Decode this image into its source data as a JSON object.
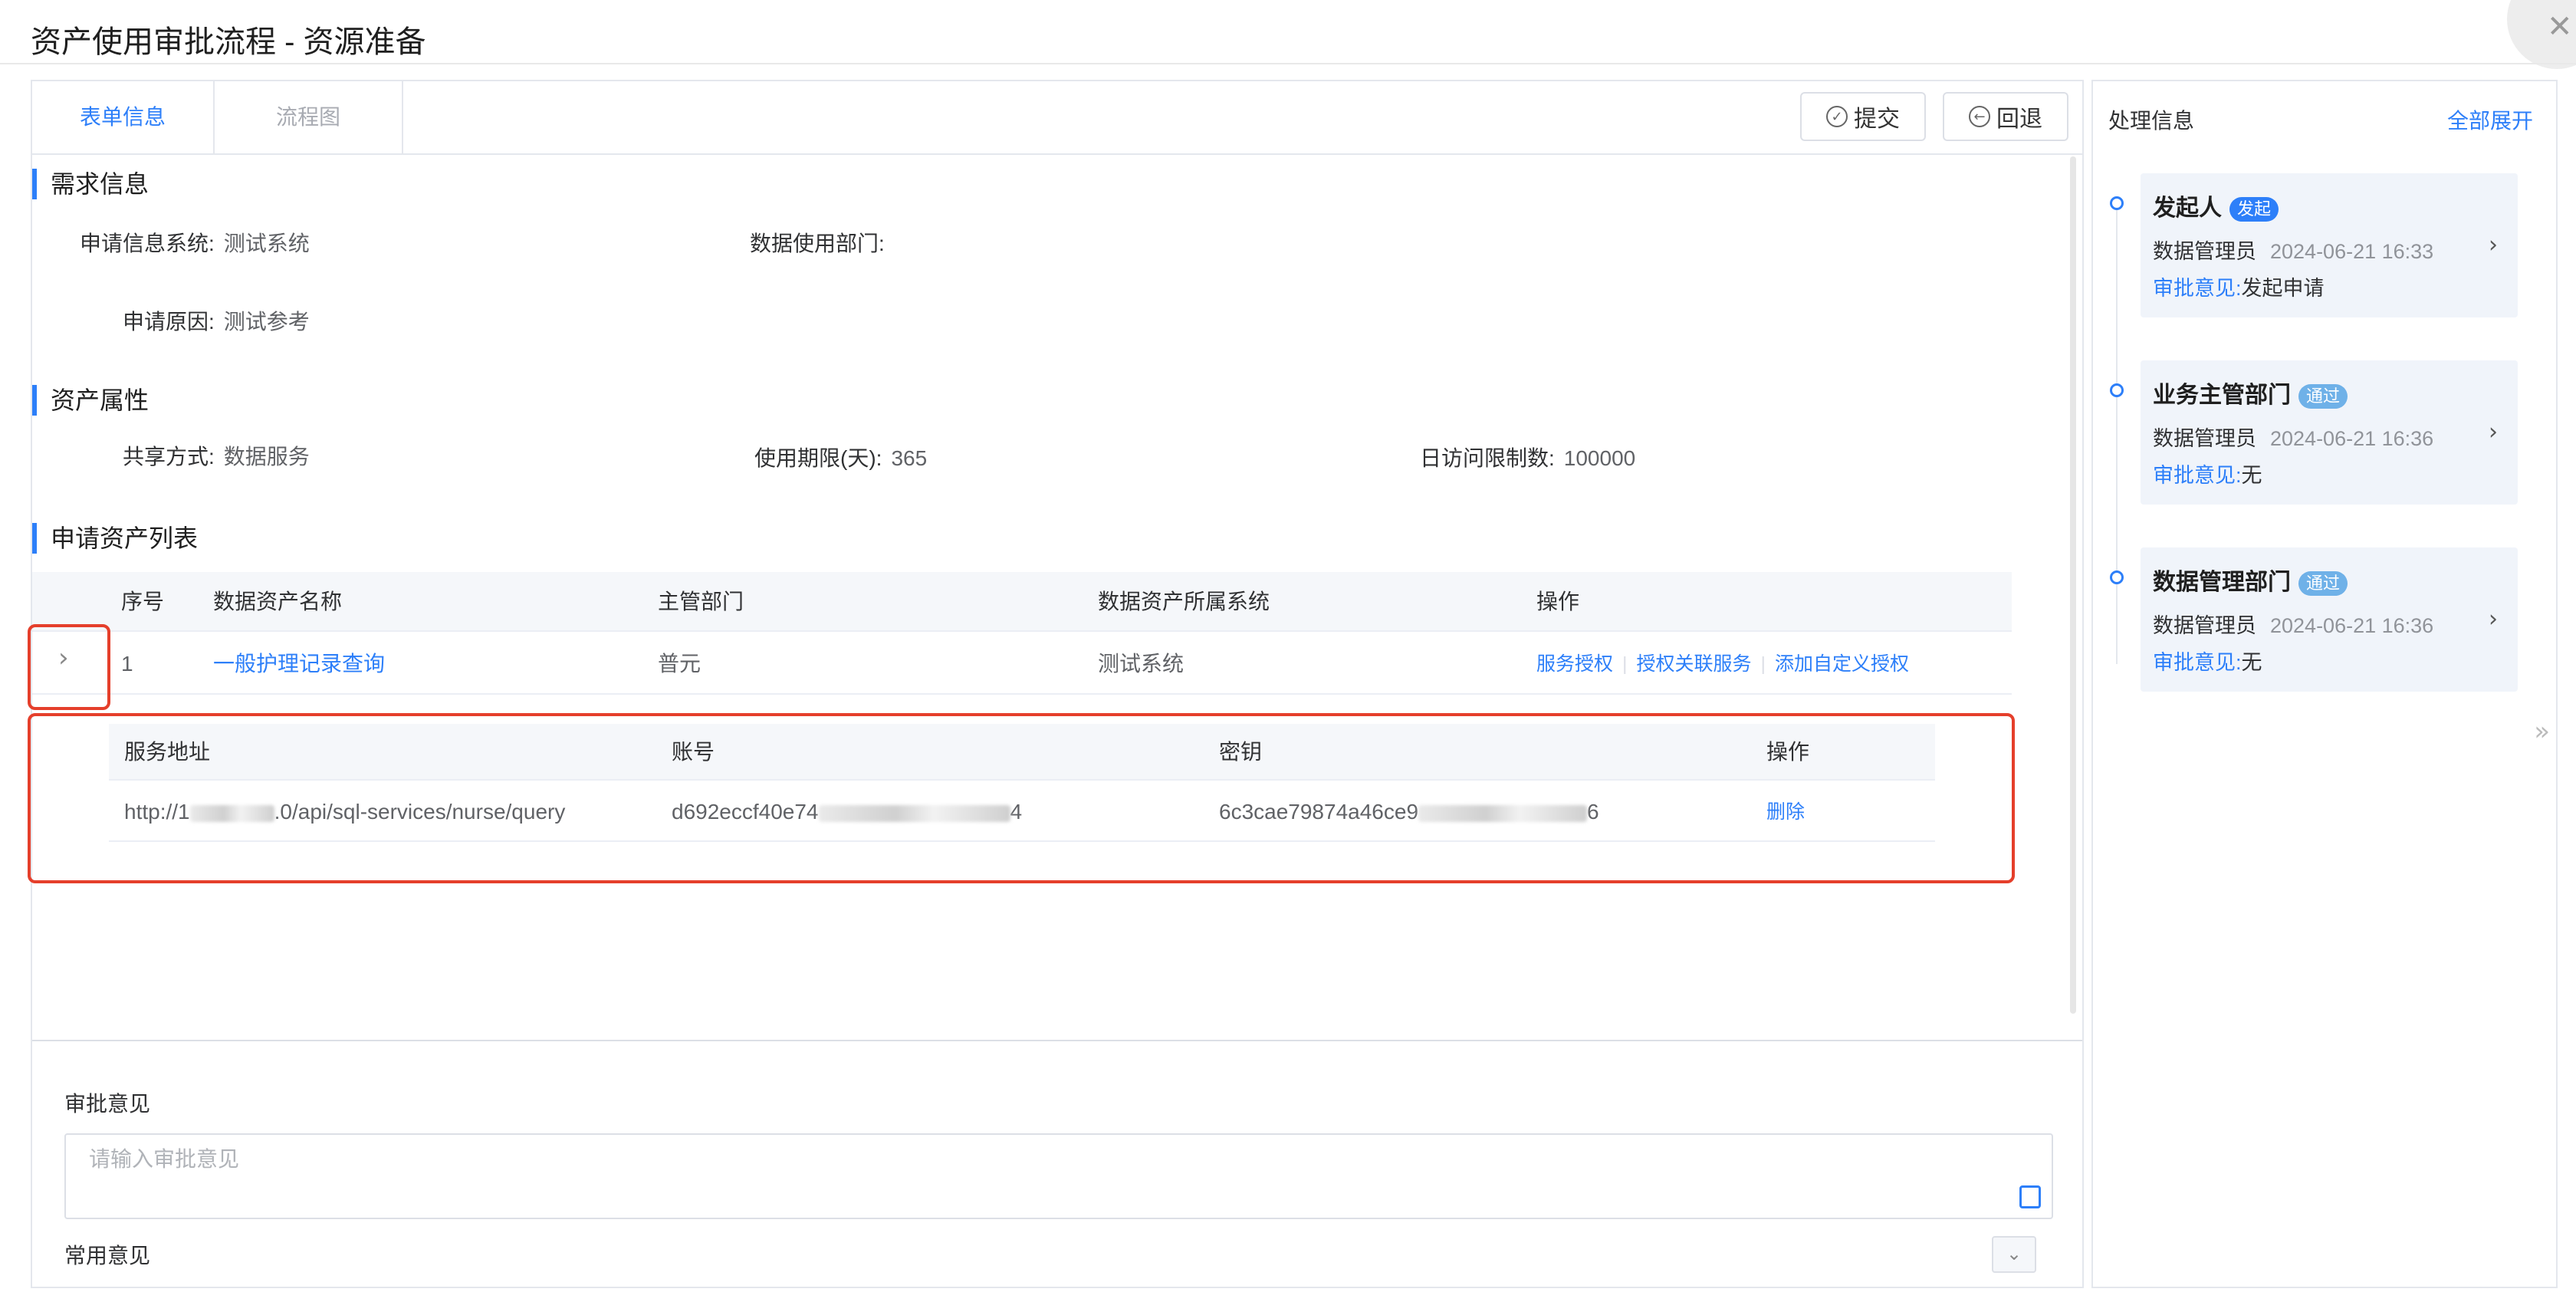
{
  "modal": {
    "title": "资产使用审批流程 - 资源准备",
    "close_icon": "close-icon"
  },
  "tabs": [
    {
      "label": "表单信息"
    },
    {
      "label": "流程图"
    }
  ],
  "toolbar": {
    "submit_label": "提交",
    "back_label": "回退"
  },
  "demand": {
    "title": "需求信息",
    "system_label": "申请信息系统:",
    "system_value": "测试系统",
    "dept_label": "数据使用部门:",
    "dept_value": "",
    "reason_label": "申请原因:",
    "reason_value": "测试参考"
  },
  "asset_props": {
    "title": "资产属性",
    "share_label": "共享方式:",
    "share_value": "数据服务",
    "period_label": "使用期限(天):",
    "period_value": "365",
    "limit_label": "日访问限制数:",
    "limit_value": "100000"
  },
  "asset_list": {
    "title": "申请资产列表",
    "columns": [
      "序号",
      "数据资产名称",
      "主管部门",
      "数据资产所属系统",
      "操作"
    ],
    "rows": [
      {
        "index": "1",
        "name": "一般护理记录查询",
        "dept": "普元",
        "system": "测试系统",
        "ops": [
          "服务授权",
          "授权关联服务",
          "添加自定义授权"
        ]
      }
    ]
  },
  "service_table": {
    "columns": [
      "服务地址",
      "账号",
      "密钥",
      "操作"
    ],
    "row": {
      "address_prefix": "http://1",
      "address_suffix": ".0/api/sql-services/nurse/query",
      "account_prefix": "d692eccf40e74",
      "account_suffix": "4",
      "secret_prefix": "6c3cae79874a46ce9",
      "secret_suffix": "6",
      "action": "删除"
    }
  },
  "opinion": {
    "label": "审批意见",
    "placeholder": "请输入审批意见",
    "common_label": "常用意见"
  },
  "process_panel": {
    "title": "处理信息",
    "expand_all": "全部展开",
    "steps": [
      {
        "title": "发起人",
        "badge": "发起",
        "user": "数据管理员",
        "time": "2024-06-21 16:33",
        "opinion_key": "审批意见:",
        "opinion": "发起申请"
      },
      {
        "title": "业务主管部门",
        "badge": "通过",
        "user": "数据管理员",
        "time": "2024-06-21 16:36",
        "opinion_key": "审批意见:",
        "opinion": "无"
      },
      {
        "title": "数据管理部门",
        "badge": "通过",
        "user": "数据管理员",
        "time": "2024-06-21 16:36",
        "opinion_key": "审批意见:",
        "opinion": "无"
      }
    ]
  },
  "colors": {
    "accent": "#2d7ff9",
    "highlight_border": "#e53f2b",
    "badge_pass": "#6fb1e8"
  }
}
